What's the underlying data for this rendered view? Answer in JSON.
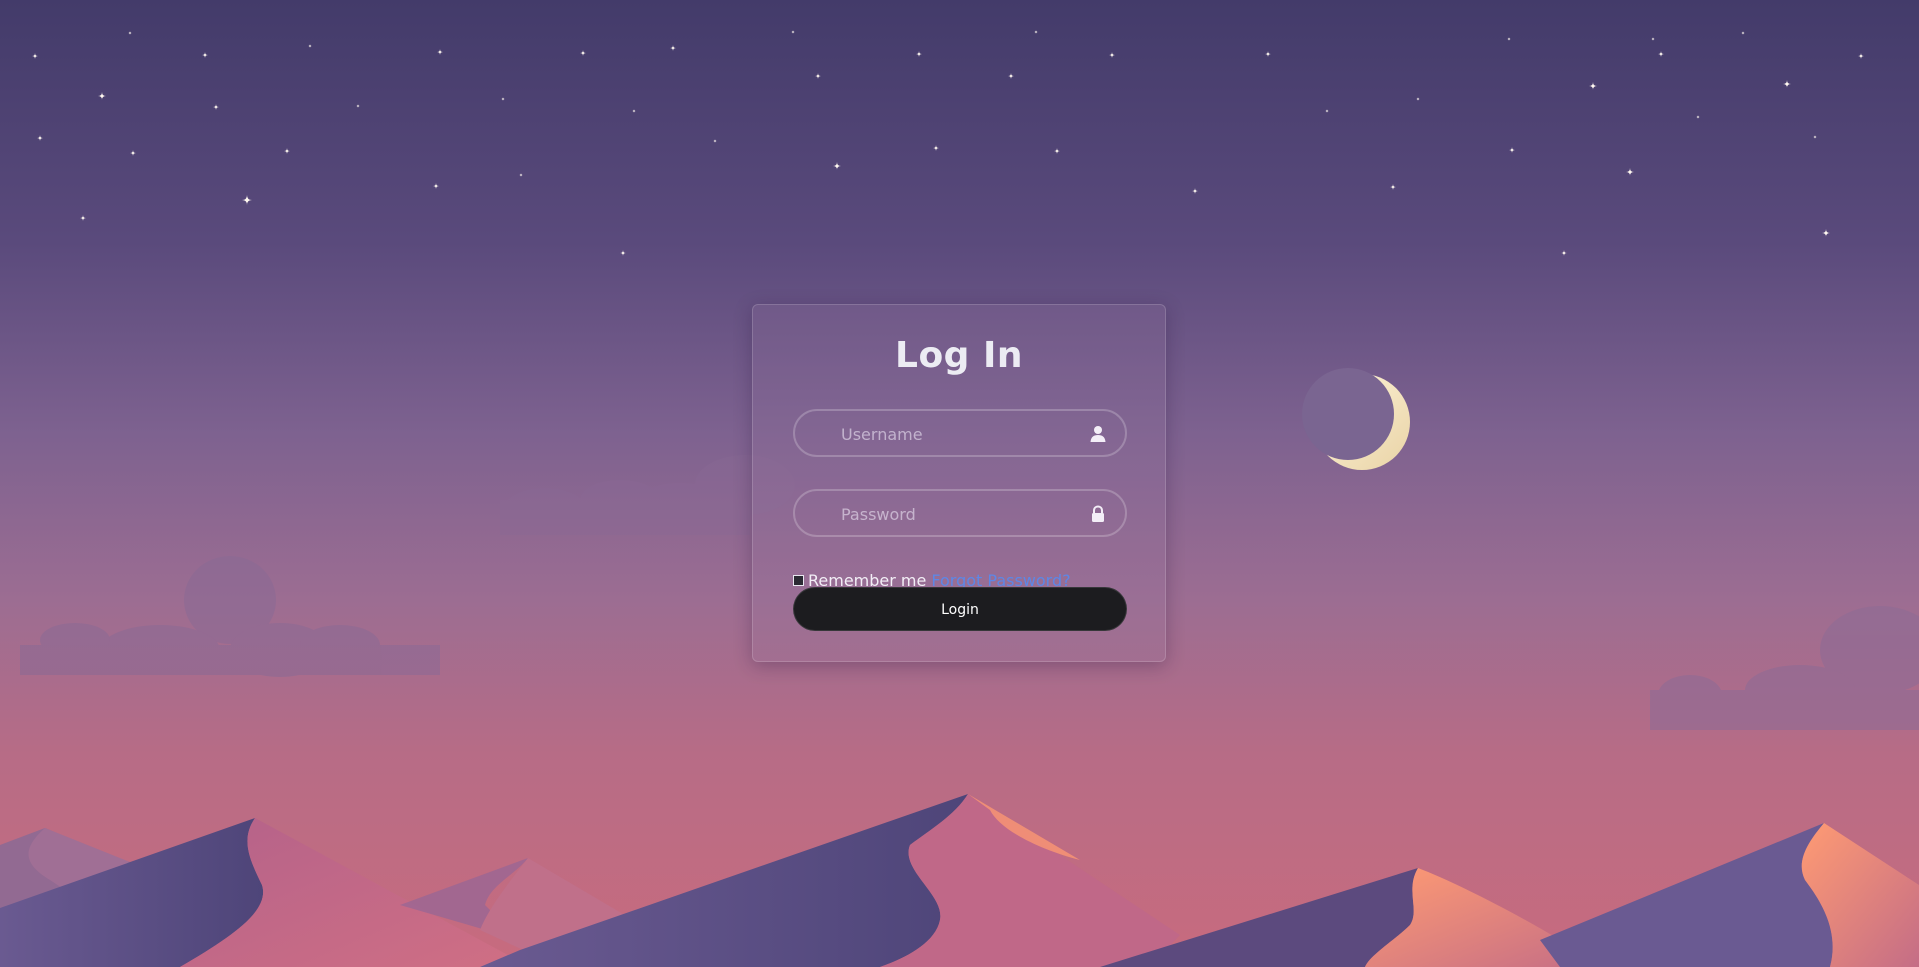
{
  "login": {
    "title": "Log In",
    "username_placeholder": "Username",
    "password_placeholder": "Password",
    "remember_label": "Remember me",
    "forgot_label": "Forgot Password?",
    "button_label": "Login",
    "remember_checked": false
  },
  "icons": {
    "username": "user-icon",
    "password": "lock-icon"
  },
  "colors": {
    "link": "#5d87e6",
    "button": "#1c1c1f",
    "moon": "#f2e6c4"
  }
}
